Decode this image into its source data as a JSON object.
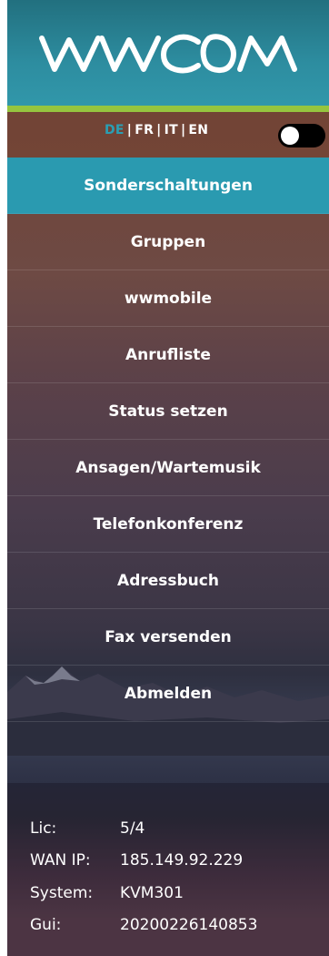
{
  "logo": {
    "text": "WWCOM",
    "icon": "wwcom-logo"
  },
  "colors": {
    "logo_bg": "#2d8da0",
    "accent_line": "#96c53f",
    "active_item": "#2a9ab0",
    "active_lang": "#2a9fb4",
    "toggle": "#000000"
  },
  "language": {
    "options": [
      "DE",
      "FR",
      "IT",
      "EN"
    ],
    "selected": "DE",
    "separator": "|"
  },
  "theme_toggle": {
    "state": "off"
  },
  "menu": {
    "items": [
      {
        "label": "Sonderschaltungen",
        "active": true
      },
      {
        "label": "Gruppen",
        "active": false
      },
      {
        "label": "wwmobile",
        "active": false
      },
      {
        "label": "Anrufliste",
        "active": false
      },
      {
        "label": "Status setzen",
        "active": false
      },
      {
        "label": "Ansagen/Wartemusik",
        "active": false
      },
      {
        "label": "Telefonkonferenz",
        "active": false
      },
      {
        "label": "Adressbuch",
        "active": false
      },
      {
        "label": "Fax versenden",
        "active": false
      },
      {
        "label": "Abmelden",
        "active": false
      }
    ]
  },
  "info": {
    "lic_label": "Lic:",
    "lic_value": "5/4",
    "wan_label": "WAN IP:",
    "wan_value": "185.149.92.229",
    "system_label": "System:",
    "system_value": "KVM301",
    "gui_label": "Gui:",
    "gui_value": "20200226140853"
  }
}
